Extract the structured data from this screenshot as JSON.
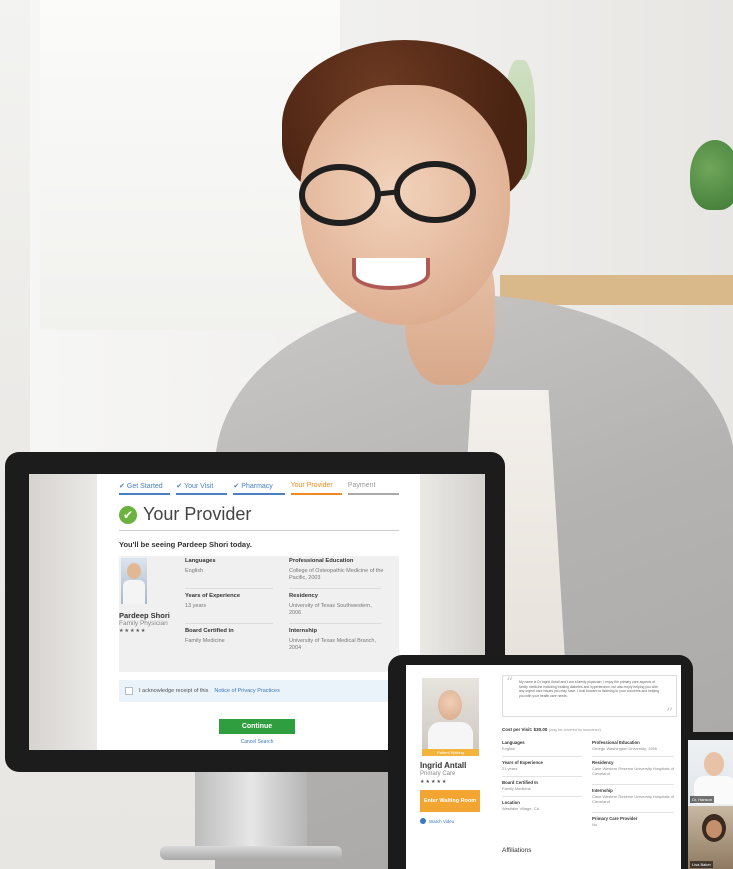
{
  "desktop": {
    "steps": [
      {
        "label": "Get Started",
        "state": "done"
      },
      {
        "label": "Your Visit",
        "state": "done"
      },
      {
        "label": "Pharmacy",
        "state": "done"
      },
      {
        "label": "Your Provider",
        "state": "current"
      },
      {
        "label": "Payment",
        "state": "todo"
      }
    ],
    "check_mark": "✔",
    "title": "Your Provider",
    "seeing": "You'll be seeing Pardeep Shori today.",
    "provider": {
      "name": "Pardeep Shori",
      "role": "Family Physician",
      "stars": "★★★★★",
      "languages_label": "Languages",
      "languages": "English",
      "years_label": "Years of Experience",
      "years": "13 years",
      "board_label": "Board Certified in",
      "board": "Family Medicine",
      "education_label": "Professional Education",
      "education": "College of Osteopathic Medicine of the Pacific, 2003",
      "residency_label": "Residency",
      "residency": "University of Texas Southwestern, 2006",
      "internship_label": "Internship",
      "internship": "University of Texas Medical Branch, 2004"
    },
    "ack_text": "I acknowledge receipt of this",
    "ack_link": "Notice of Privacy Practices",
    "continue_label": "Continue",
    "cancel_label": "Cancel Search"
  },
  "tablet": {
    "badge": "Patient Waiting",
    "quote": "My name is Dr Ingrid Antall and I am a family physician. I enjoy the primary care aspects of family medicine including treating diabetes and hypertension, but also enjoy helping you with any urgent care issues you may have. I look forward to listening to your concerns and helping you with your health care needs.",
    "name": "Ingrid Antall",
    "role": "Primary Care",
    "stars": "★★★★★",
    "enter_label": "Enter Waiting Room",
    "video_label": "Watch Video",
    "cost": "Cost per Visit: $30.00",
    "cost_note": "(may be covered by insurance)",
    "languages_label": "Languages",
    "languages": "English",
    "years_label": "Years of Experience",
    "years": "21 years",
    "board_label": "Board Certified In",
    "board": "Family Medicine",
    "location_label": "Location",
    "location": "Westlake Village, CA",
    "education_label": "Professional Education",
    "education": "George Washington University, 1995",
    "residency_label": "Residency",
    "residency": "Case Western Reserve University Hospitals of Cleveland",
    "internship_label": "Internship",
    "internship": "Case Western Reserve University Hospitals of Cleveland",
    "pcp_label": "Primary Care Provider",
    "pcp": "No",
    "affiliations": "Affiliations"
  },
  "phone": {
    "top_label": "Dr. Hanson",
    "bottom_label": "Lisa Baker"
  },
  "colors": {
    "done": "#4a7fc1",
    "current": "#f08a24",
    "continue": "#2f9e3e",
    "enter": "#f3a531",
    "check": "#6bb33e"
  }
}
